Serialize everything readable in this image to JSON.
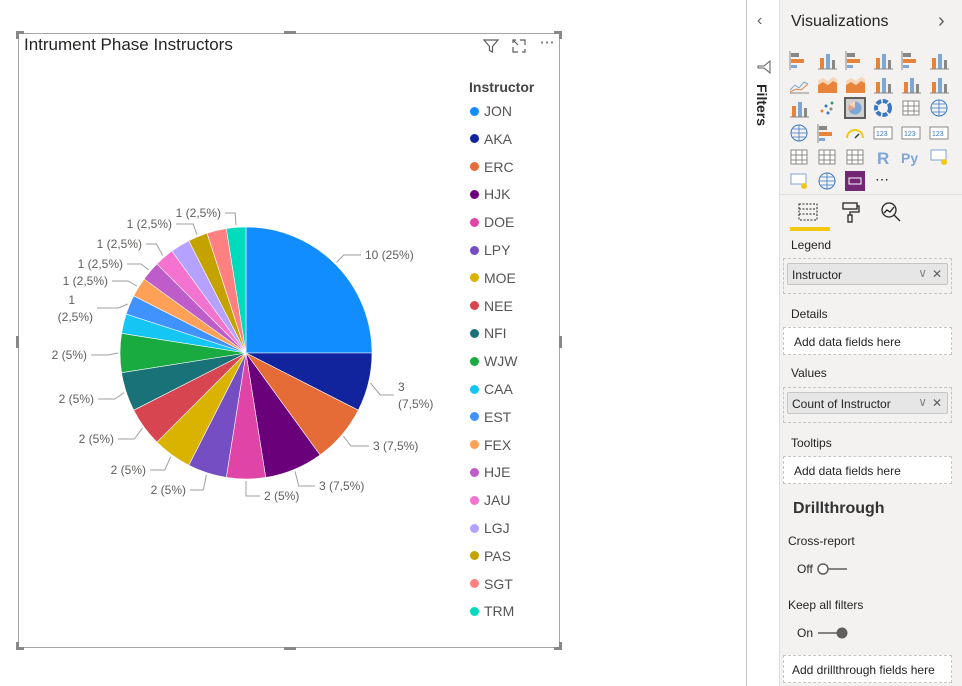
{
  "visual": {
    "title": "Intrument Phase Instructors",
    "header_icons": [
      "filter-icon",
      "focus-mode-icon",
      "more-options-icon"
    ],
    "more_label": "⋯"
  },
  "chart_data": {
    "type": "pie",
    "title": "Intrument Phase Instructors",
    "legend_title": "Instructor",
    "legend_position": "right",
    "categories": [
      "JON",
      "AKA",
      "ERC",
      "HJK",
      "DOE",
      "LPY",
      "MOE",
      "NEE",
      "NFI",
      "WJW",
      "CAA",
      "EST",
      "FEX",
      "HJE",
      "JAU",
      "LGJ",
      "PAS",
      "SGT",
      "TRM"
    ],
    "values": [
      10,
      3,
      3,
      3,
      2,
      2,
      2,
      2,
      2,
      2,
      1,
      1,
      1,
      1,
      1,
      1,
      1,
      1,
      1
    ],
    "colors": [
      "#118DFF",
      "#12239E",
      "#E66C37",
      "#6B007B",
      "#E044A7",
      "#744EC2",
      "#D9B300",
      "#D64550",
      "#197278",
      "#1AAB40",
      "#15C6F4",
      "#4092FF",
      "#FFA058",
      "#BE5DC9",
      "#F472D0",
      "#B5A1FF",
      "#C4A200",
      "#FF8080",
      "#00DBBC"
    ],
    "data_labels": {
      "JON": "10 (25%)",
      "AKA": "3 (7,5%)",
      "ERC": "3 (7,5%)",
      "HJK": "3 (7,5%)",
      "DOE": "2 (5%)",
      "LPY": "2 (5%)",
      "MOE": "2 (5%)",
      "NEE": "2 (5%)",
      "NFI": "2 (5%)",
      "WJW": "2 (5%)",
      "EST": "1 (2,5%)",
      "FEX": "1 (2,5%)",
      "HJE": "1 (2,5%)",
      "JAU": "1 (2,5%)",
      "PAS": "1 (2,5%)",
      "TRM": "1 (2,5%)"
    }
  },
  "filters_pane": {
    "label": "Filters",
    "collapse_icon": "chevron-left-icon",
    "icon": "filter-icon"
  },
  "visualizations": {
    "title": "Visualizations",
    "collapse_icon": "chevron-right-icon",
    "icons": [
      "stacked-bar",
      "stacked-column",
      "clustered-bar",
      "clustered-column",
      "100-stacked-bar",
      "100-stacked-column",
      "line",
      "area",
      "stacked-area",
      "line-stacked-column",
      "line-clustered-column",
      "ribbon",
      "waterfall",
      "scatter",
      "pie",
      "donut",
      "treemap",
      "map",
      "filled-map",
      "funnel",
      "gauge",
      "card",
      "multi-row-card",
      "kpi",
      "slicer",
      "table",
      "matrix",
      "r-script",
      "python",
      "key-influencers",
      "qa",
      "arcgis",
      "power-apps",
      "more"
    ],
    "selected": "pie",
    "tabs": [
      "fields",
      "format",
      "analytics"
    ],
    "active_tab": "fields"
  },
  "fields": {
    "legend_label": "Legend",
    "legend_value": "Instructor",
    "details_label": "Details",
    "details_placeholder": "Add data fields here",
    "values_label": "Values",
    "values_value": "Count of Instructor",
    "tooltips_label": "Tooltips",
    "tooltips_placeholder": "Add data fields here"
  },
  "drillthrough": {
    "title": "Drillthrough",
    "cross_report_label": "Cross-report",
    "cross_report_state": "Off",
    "keep_filters_label": "Keep all filters",
    "keep_filters_state": "On",
    "placeholder": "Add drillthrough fields here"
  }
}
